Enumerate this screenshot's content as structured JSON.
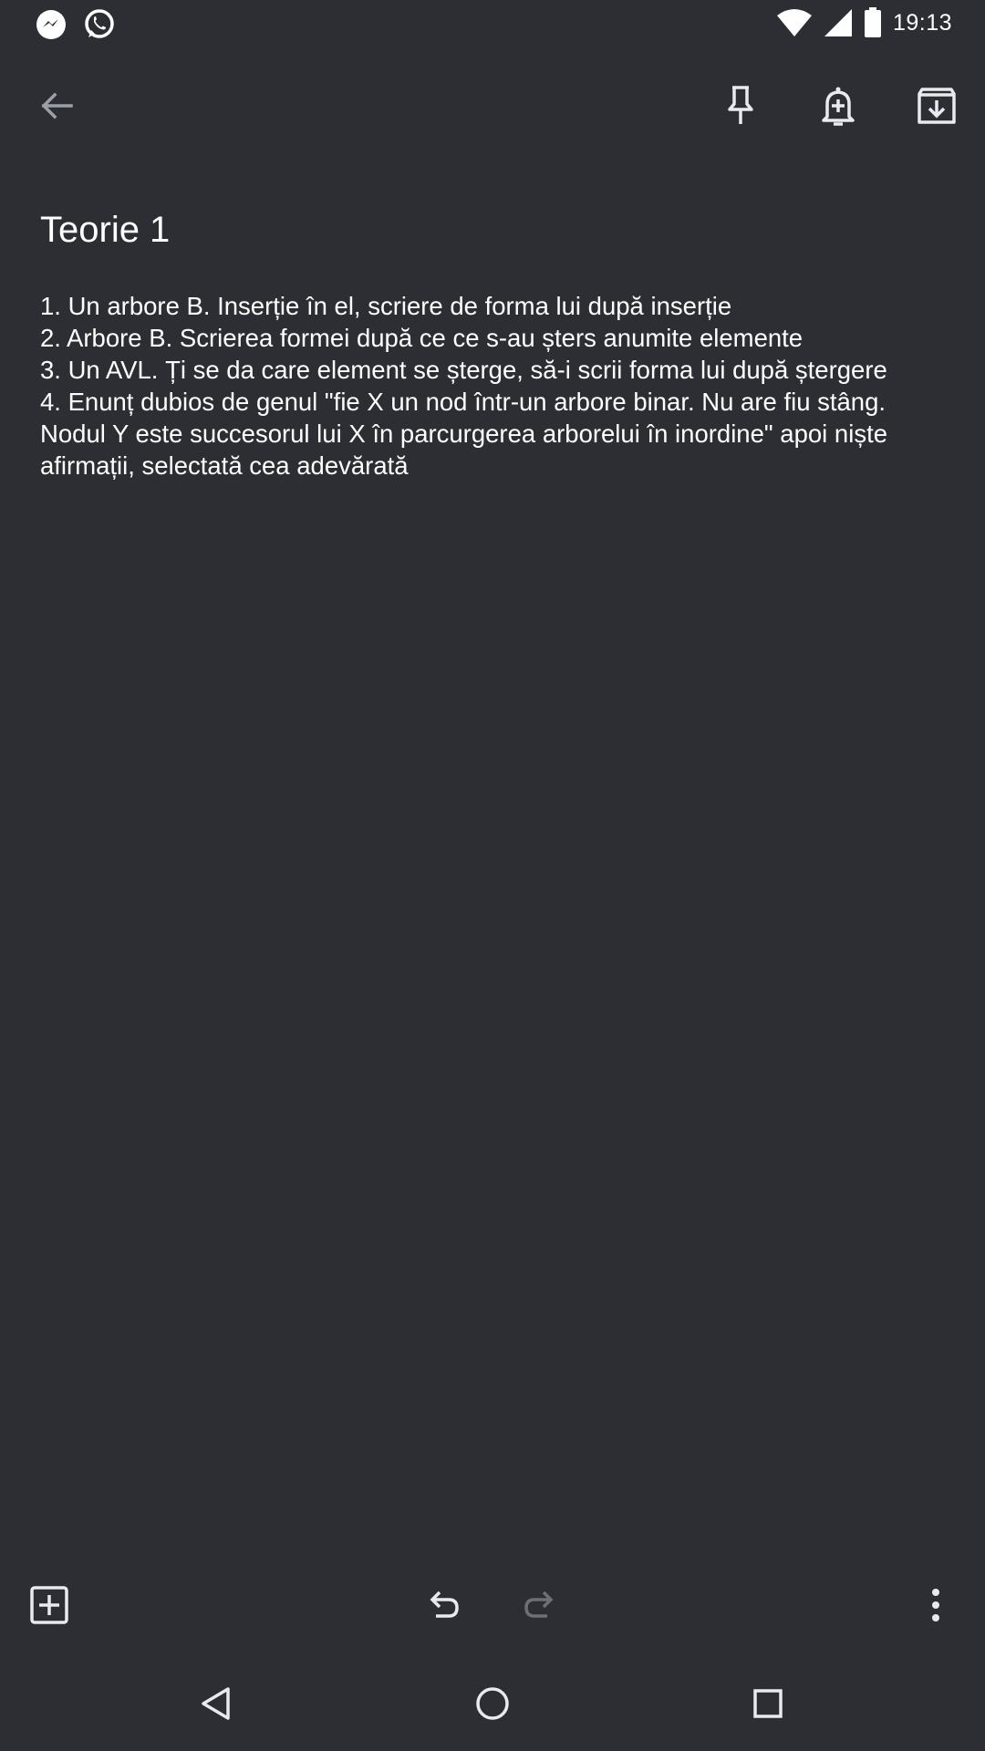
{
  "status_bar": {
    "time": "19:13",
    "notification_icons": [
      "messenger-icon",
      "whatsapp-icon"
    ],
    "system_icons": [
      "wifi-icon",
      "cell-signal-icon",
      "battery-icon"
    ]
  },
  "toolbar": {
    "icons": [
      "back-arrow-icon",
      "pin-icon",
      "reminder-bell-icon",
      "archive-icon"
    ]
  },
  "note": {
    "title": "Teorie 1",
    "body": "1. Un arbore B. Inserție în el, scriere de forma lui după inserție\n2. Arbore B. Scrierea formei după ce ce s-au șters anumite elemente\n3. Un AVL. Ți se da care element se șterge, să-i scrii forma lui după ștergere\n4. Enunț dubios de genul \"fie X un nod într-un arbore binar. Nu are fiu stâng. Nodul Y este succesorul lui X în parcurgerea arborelui în inordine\" apoi niște afirmații, selectată cea adevărată"
  },
  "bottom_bar": {
    "icons": [
      "add-box-icon",
      "undo-icon",
      "redo-icon",
      "more-vert-icon"
    ]
  },
  "nav_bar": {
    "icons": [
      "nav-back-icon",
      "nav-home-icon",
      "nav-recents-icon"
    ]
  },
  "colors": {
    "background": "#2d2e33",
    "text": "#ffffff",
    "icon": "#e8eaed",
    "icon_disabled": "#6d6f74"
  }
}
